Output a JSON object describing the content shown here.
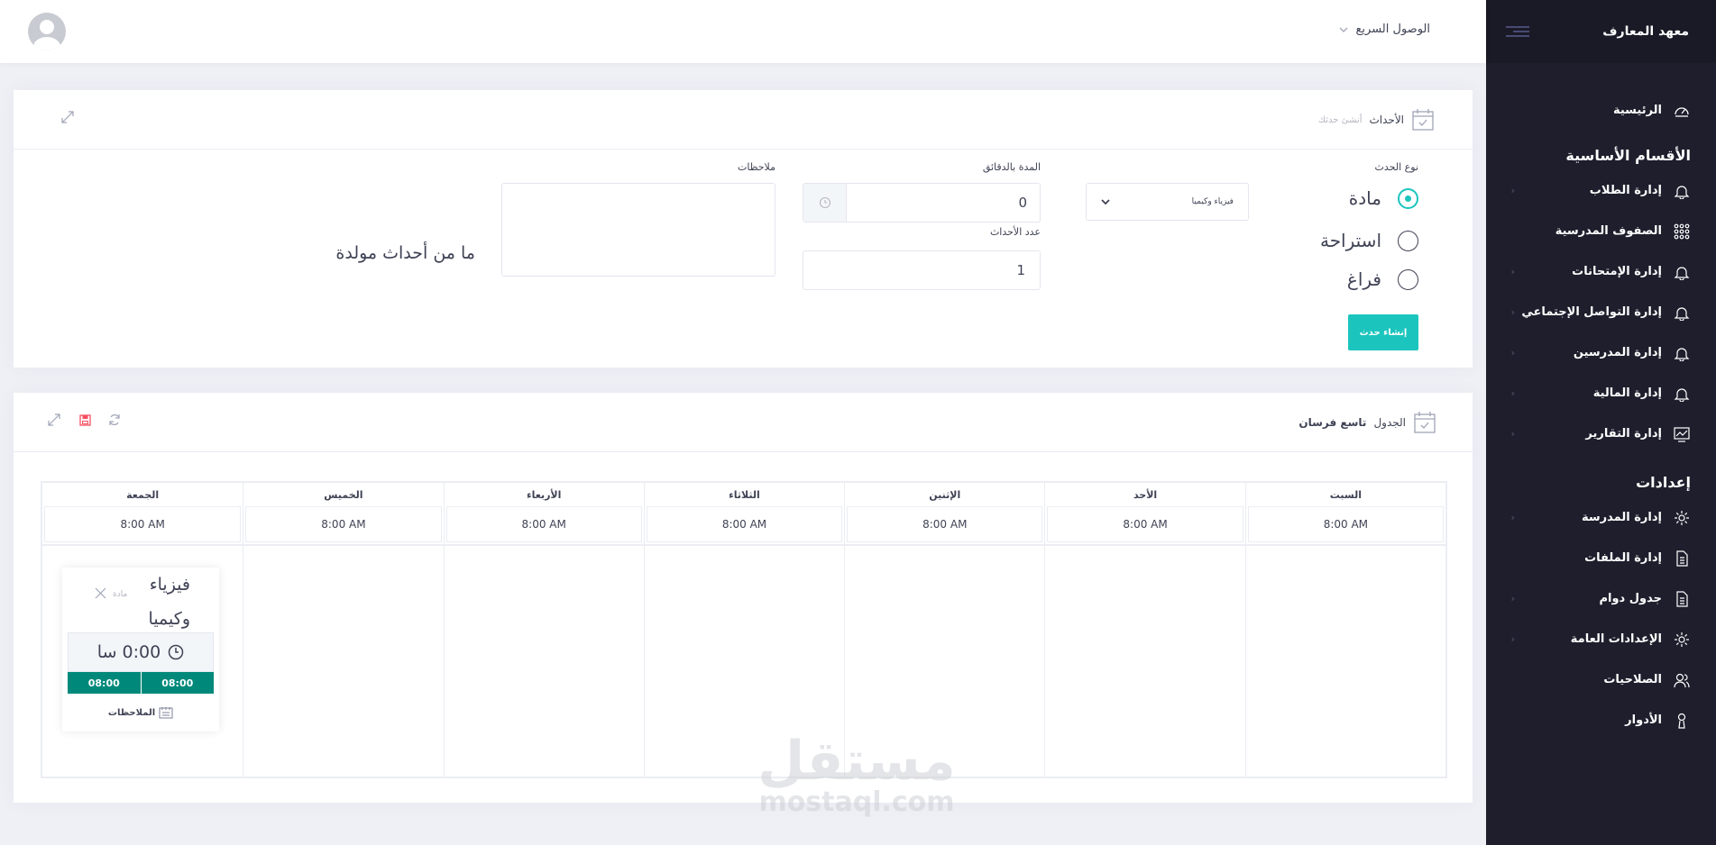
{
  "sidebar": {
    "brand": "معهد المعارف",
    "items_main": [
      {
        "label": "الرئيسية",
        "icon": "dashboard-icon"
      }
    ],
    "section_main": "الأقسام الأساسية",
    "items_core": [
      {
        "label": "إدارة الطلاب",
        "icon": "bell-icon",
        "arrow": "‹"
      },
      {
        "label": "الصفوف المدرسية",
        "icon": "grid-icon",
        "arrow": ""
      },
      {
        "label": "إدارة الإمتحانات",
        "icon": "bell-icon",
        "arrow": "‹"
      },
      {
        "label": "إدارة التواصل الإجتماعي",
        "icon": "bell-icon",
        "arrow": "‹"
      },
      {
        "label": "إدارة المدرسين",
        "icon": "bell-icon",
        "arrow": "‹"
      },
      {
        "label": "إدارة المالية",
        "icon": "bell-icon",
        "arrow": "‹"
      },
      {
        "label": "إدارة التقارير",
        "icon": "chart-icon",
        "arrow": "‹"
      }
    ],
    "section_settings": "إعدادات",
    "items_settings": [
      {
        "label": "إدارة المدرسة",
        "icon": "gear-icon",
        "arrow": "‹"
      },
      {
        "label": "إدارة الملفات",
        "icon": "file-icon",
        "arrow": ""
      },
      {
        "label": "جدول دوام",
        "icon": "file-icon",
        "arrow": "‹"
      },
      {
        "label": "الإعدادات العامة",
        "icon": "gear-icon",
        "arrow": "‹"
      },
      {
        "label": "الصلاحيات",
        "icon": "users-icon",
        "arrow": ""
      },
      {
        "label": "الأدوار",
        "icon": "user-icon",
        "arrow": ""
      }
    ]
  },
  "header": {
    "quick_access": "الوصول السريع"
  },
  "events_card": {
    "title": "الأحداث",
    "subtitle": "أنشئ حدثك",
    "type_label": "نوع الحدث",
    "types": [
      {
        "label": "مادة",
        "checked": true
      },
      {
        "label": "استراحة",
        "checked": false
      },
      {
        "label": "فراغ",
        "checked": false
      }
    ],
    "subject_select": "فيزياء وكيميا",
    "duration_label": "المدة بالدقائق",
    "duration_value": "0",
    "count_label": "عدد الأحداث",
    "count_value": "1",
    "notes_label": "ملاحظات",
    "create_button": "إنشاء حدث",
    "empty_message": "ما من أحداث مولدة"
  },
  "schedule_card": {
    "title": "الجدول",
    "class_name": "تاسع فرسان",
    "days": [
      "الجمعة",
      "الخميس",
      "الأربعاء",
      "الثلاثاء",
      "الإثنين",
      "الأحد",
      "السبت"
    ],
    "start_time": "8:00 AM",
    "event": {
      "name": "فيزياء وكيميا",
      "type": "مادة",
      "duration": "0:00 سا",
      "start": "08:00",
      "end": "08:00",
      "notes_label": "الملاحظات"
    }
  },
  "watermark": {
    "arabic": "مستقل",
    "latin": "mostaql.com"
  },
  "colors": {
    "accent": "#1bc5bd",
    "teal_bar": "#00897b",
    "sidebar_bg": "#1e1e2d"
  }
}
